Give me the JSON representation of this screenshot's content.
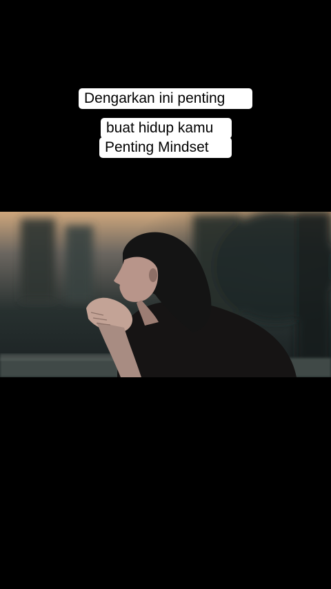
{
  "caption": {
    "lines": [
      "Dengarkan ini penting",
      "buat hidup kamu",
      "Penting Mindset"
    ]
  },
  "video": {
    "subject": "woman-thinking",
    "palette": {
      "sky": "#c9a57e",
      "background": "#1f2a2c",
      "hair": "#141414",
      "skin": "#b8958a",
      "jacket": "#161414"
    }
  }
}
